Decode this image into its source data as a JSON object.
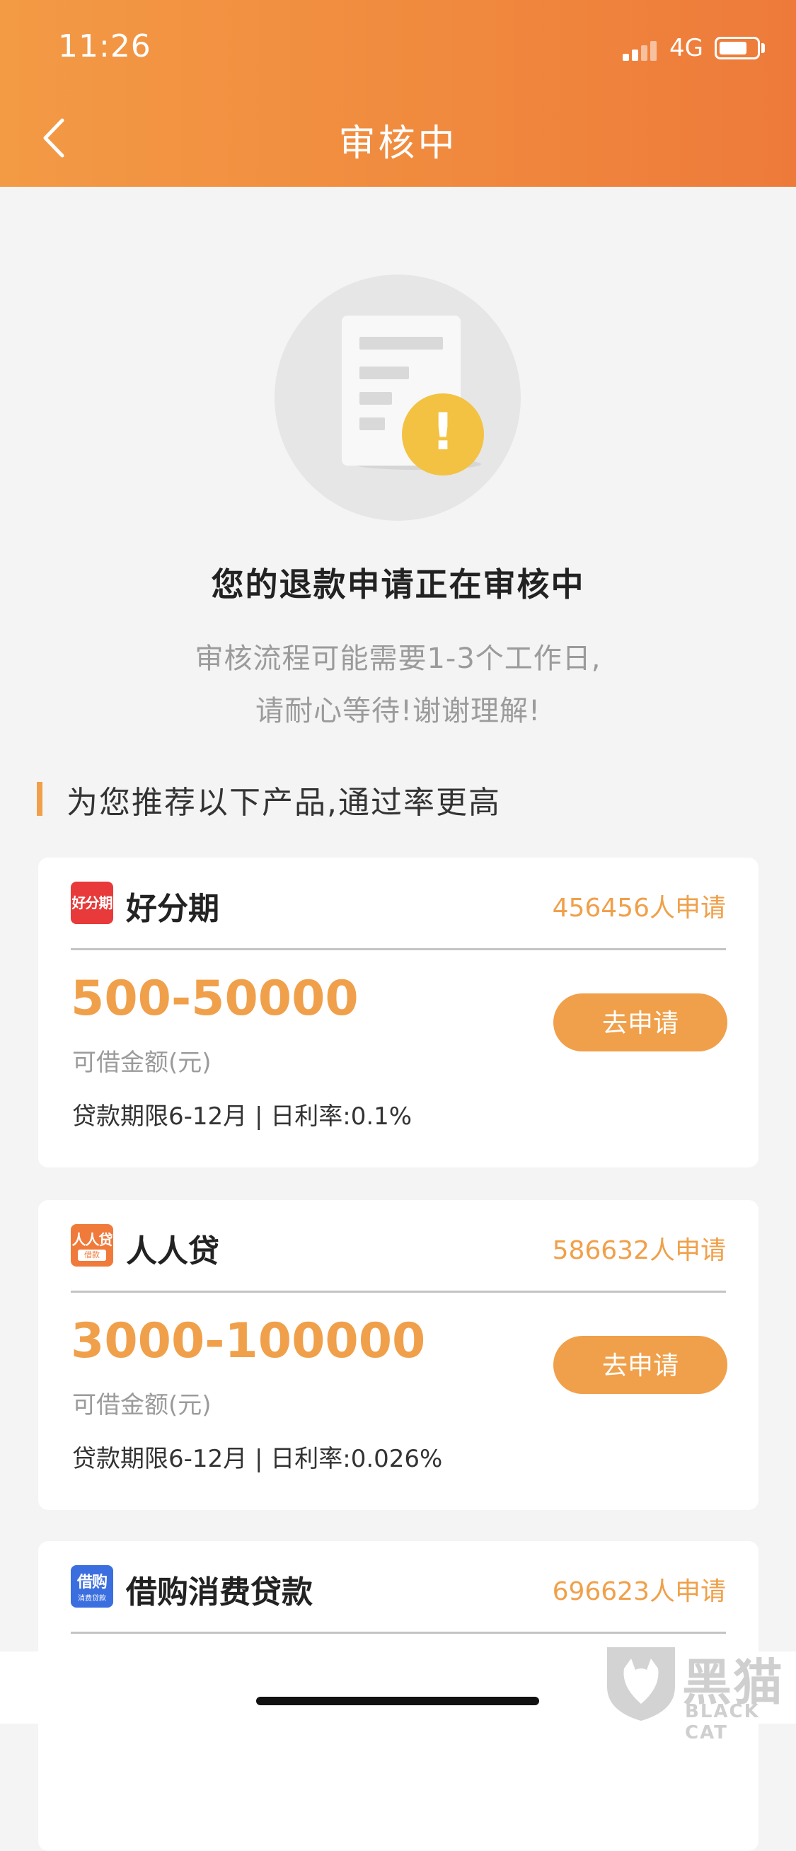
{
  "status_bar": {
    "time": "11:26",
    "network": "4G"
  },
  "nav": {
    "title": "审核中",
    "back_icon": "chevron-left-icon"
  },
  "message": {
    "main": "您的退款申请正在审核中",
    "sub_line1": "审核流程可能需要1-3个工作日,",
    "sub_line2": "请耐心等待!谢谢理解!"
  },
  "recommend": {
    "title": "为您推荐以下产品,通过率更高"
  },
  "products": [
    {
      "logo_text": "好分期",
      "name": "好分期",
      "applicants": "456456人申请",
      "amount": "500-50000",
      "amount_label": "可借金额(元)",
      "terms": "贷款期限6-12月 | 日利率:0.1%",
      "button": "去申请",
      "logo_color": "#e83a3a"
    },
    {
      "logo_text": "人人贷",
      "logo_sub": "借款",
      "name": "人人贷",
      "applicants": "586632人申请",
      "amount": "3000-100000",
      "amount_label": "可借金额(元)",
      "terms": "贷款期限6-12月 | 日利率:0.026%",
      "button": "去申请",
      "logo_color": "#f07a3a"
    },
    {
      "logo_text": "借购",
      "logo_sub": "消费贷款",
      "name": "借购消费贷款",
      "applicants": "696623人申请",
      "logo_color": "#3b6fe0"
    }
  ],
  "watermark": {
    "cn": "黑猫",
    "en": "BLACK CAT"
  },
  "colors": {
    "header_start": "#f39a45",
    "header_end": "#ee7a3a",
    "accent": "#f0a04a",
    "warning": "#f3c242"
  }
}
